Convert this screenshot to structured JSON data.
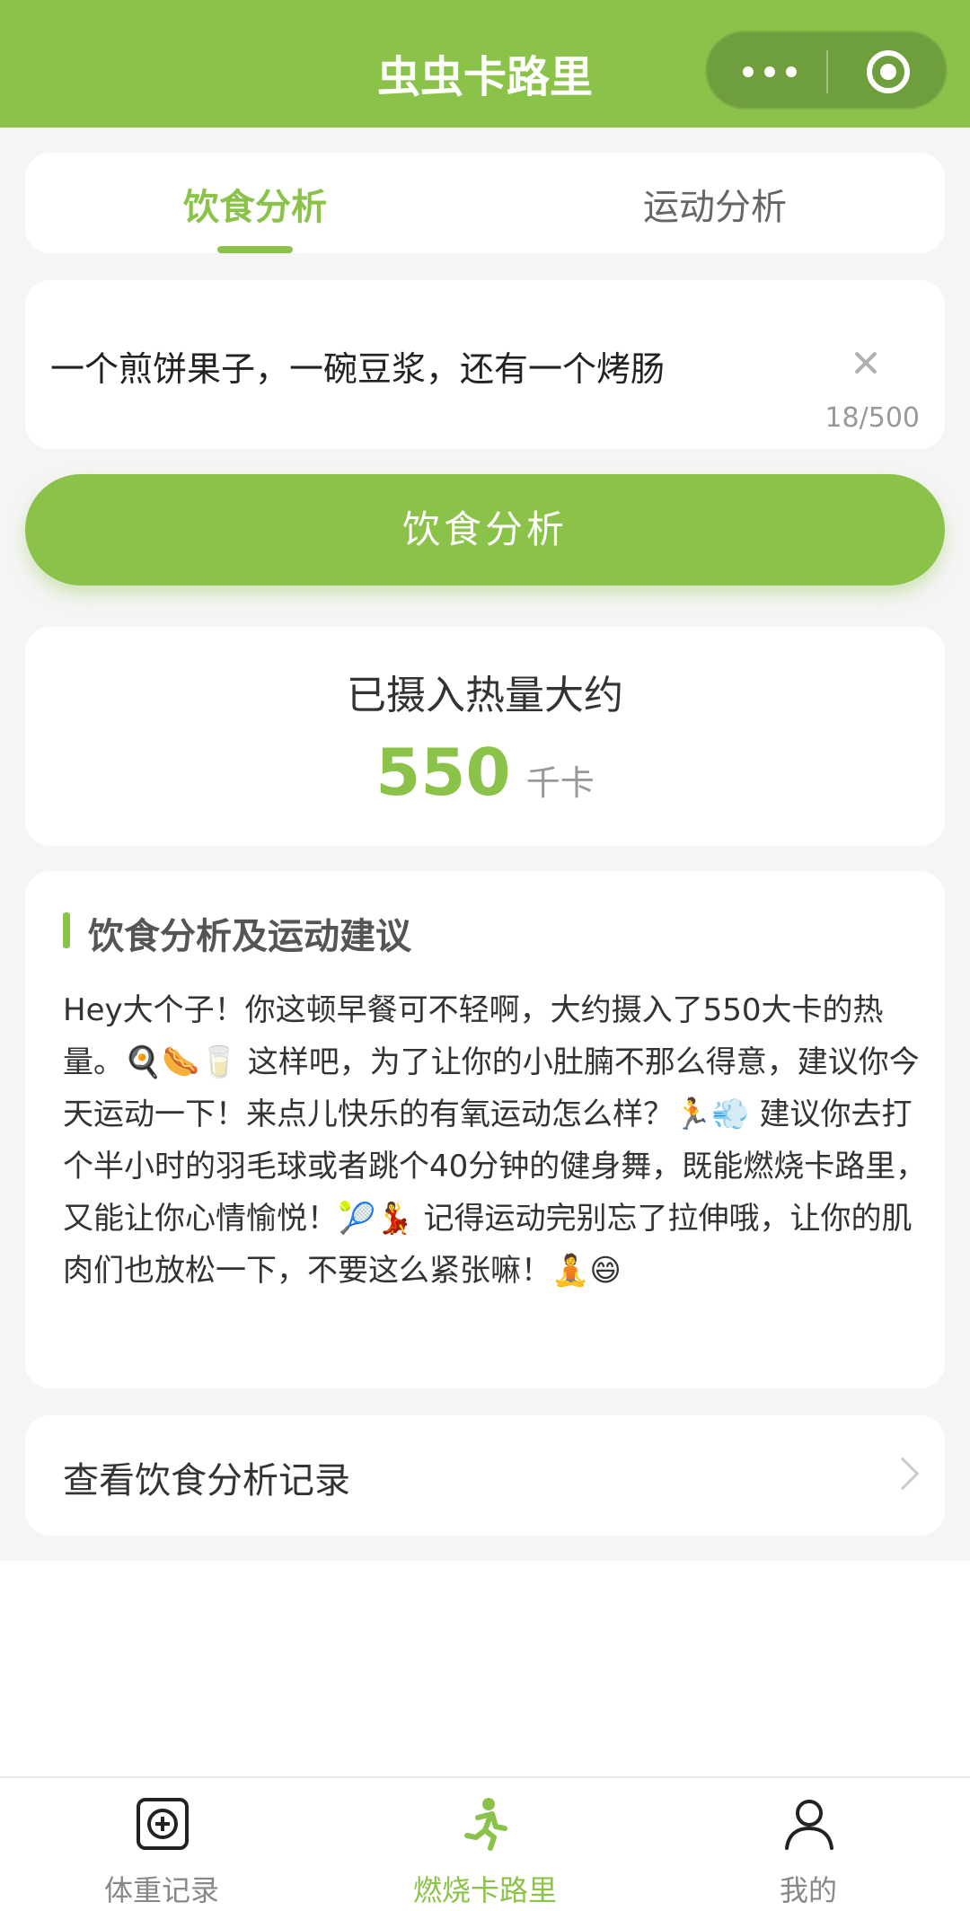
{
  "header": {
    "title": "虫虫卡路里"
  },
  "tabs": [
    {
      "label": "饮食分析",
      "active": true
    },
    {
      "label": "运动分析",
      "active": false
    }
  ],
  "input": {
    "value": "一个煎饼果子，一碗豆浆，还有一个烤肠",
    "char_count": "18/500"
  },
  "analyze_button": {
    "label": "饮食分析"
  },
  "calorie": {
    "label": "已摄入热量大约",
    "value": "550",
    "unit": "千卡"
  },
  "advice": {
    "title": "饮食分析及运动建议",
    "body": "Hey大个子！你这顿早餐可不轻啊，大约摄入了550大卡的热量。🍳🌭🥛 这样吧，为了让你的小肚腩不那么得意，建议你今天运动一下！来点儿快乐的有氧运动怎么样？🏃💨 建议你去打个半小时的羽毛球或者跳个40分钟的健身舞，既能燃烧卡路里，又能让你心情愉悦！🎾💃 记得运动完别忘了拉伸哦，让你的肌肉们也放松一下，不要这么紧张嘛！🧘😄"
  },
  "history": {
    "label": "查看饮食分析记录"
  },
  "tabbar": [
    {
      "label": "体重记录",
      "icon": "add-box-icon",
      "active": false
    },
    {
      "label": "燃烧卡路里",
      "icon": "running-icon",
      "active": true
    },
    {
      "label": "我的",
      "icon": "person-icon",
      "active": false
    }
  ],
  "colors": {
    "brand_green": "#8bc34a",
    "inactive_gray": "#888888"
  }
}
